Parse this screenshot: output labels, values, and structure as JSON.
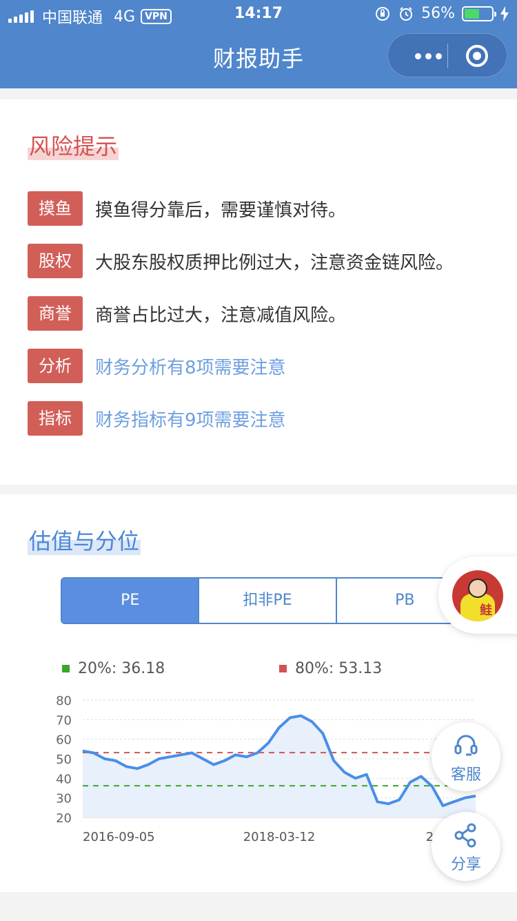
{
  "status_bar": {
    "carrier": "中国联通",
    "network": "4G",
    "vpn": "VPN",
    "time": "14:17",
    "battery": "56%"
  },
  "nav": {
    "title": "财报助手"
  },
  "risk_section": {
    "title": "风险提示",
    "items": [
      {
        "tag": "摸鱼",
        "text": "摸鱼得分靠后，需要谨慎对待。",
        "link": false
      },
      {
        "tag": "股权",
        "text": "大股东股权质押比例过大，注意资金链风险。",
        "link": false
      },
      {
        "tag": "商誉",
        "text": "商誉占比过大，注意减值风险。",
        "link": false
      },
      {
        "tag": "分析",
        "text": "财务分析有8项需要注意",
        "link": true
      },
      {
        "tag": "指标",
        "text": "财务指标有9项需要注意",
        "link": true
      }
    ]
  },
  "valuation_section": {
    "title": "估值与分位",
    "tabs": [
      "PE",
      "扣非PE",
      "PB"
    ],
    "active_tab": "PE",
    "legend": {
      "p20": {
        "label": "20%: 36.18",
        "color": "#3aa62a"
      },
      "p80": {
        "label": "80%: 53.13",
        "color": "#d25352"
      }
    }
  },
  "chart_data": {
    "type": "line",
    "title": "",
    "xlabel": "",
    "ylabel": "",
    "ylim": [
      20,
      80
    ],
    "yticks": [
      80,
      70,
      60,
      50,
      40,
      30,
      20
    ],
    "x_tick_labels": [
      "2016-09-05",
      "2018-03-12",
      "2019-09-05"
    ],
    "x": [
      "2016-09",
      "2016-10",
      "2016-11",
      "2016-12",
      "2017-01",
      "2017-02",
      "2017-03",
      "2017-04",
      "2017-05",
      "2017-06",
      "2017-07",
      "2017-08",
      "2017-09",
      "2017-10",
      "2017-11",
      "2017-12",
      "2018-01",
      "2018-02",
      "2018-03",
      "2018-04",
      "2018-05",
      "2018-06",
      "2018-07",
      "2018-08",
      "2018-09",
      "2018-10",
      "2018-11",
      "2018-12",
      "2019-01",
      "2019-02",
      "2019-03",
      "2019-04",
      "2019-05",
      "2019-06",
      "2019-07",
      "2019-08",
      "2019-09"
    ],
    "series": [
      {
        "values": [
          54,
          53,
          50,
          49,
          46,
          45,
          47,
          50,
          51,
          52,
          53,
          50,
          47,
          49,
          52,
          51,
          53,
          58,
          66,
          71,
          72,
          69,
          63,
          49,
          43,
          40,
          42,
          28,
          27,
          29,
          38,
          41,
          36,
          26,
          28,
          30,
          31
        ]
      }
    ],
    "reference_lines": [
      {
        "label": "20%",
        "value": 36.18,
        "color": "#3aa62a"
      },
      {
        "label": "80%",
        "value": 53.13,
        "color": "#d25352"
      }
    ],
    "grid": true,
    "line_color": "#4a8ee8",
    "fill_color": "#e8f0fb"
  },
  "floating": {
    "mascot_char": "鲑",
    "service_label": "客服",
    "share_label": "分享"
  }
}
